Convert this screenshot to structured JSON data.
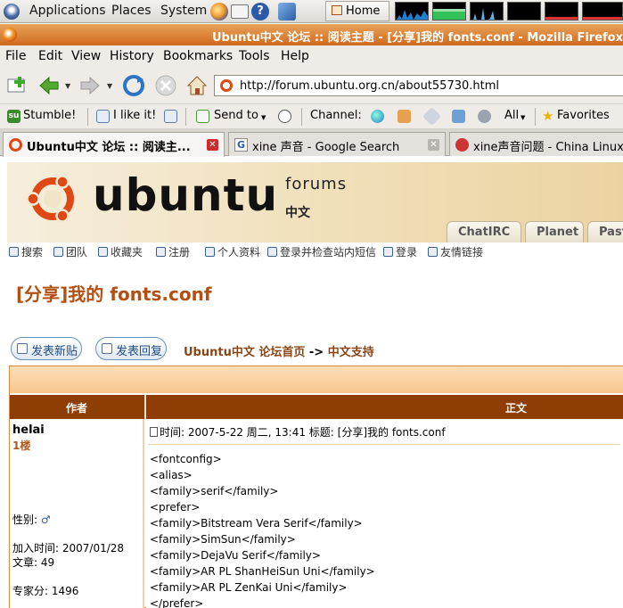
{
  "panel": {
    "applications": "Applications",
    "places": "Places",
    "system": "System",
    "home": "Home"
  },
  "window": {
    "title": "Ubuntu中文 论坛 :: 阅读主题 - [分享]我的 fonts.conf - Mozilla Firefox"
  },
  "menu": {
    "file": "File",
    "edit": "Edit",
    "view": "View",
    "history": "History",
    "bookmarks": "Bookmarks",
    "tools": "Tools",
    "help": "Help"
  },
  "nav": {
    "url": "http://forum.ubuntu.org.cn/about55730.html"
  },
  "stumble": {
    "stumble": "Stumble!",
    "like": "I like it!",
    "send_to": "Send to",
    "channel": "Channel:",
    "all": "All",
    "favorites": "Favorites"
  },
  "tabs": [
    {
      "label": "Ubuntu中文 论坛 :: 阅读主..."
    },
    {
      "label": "xine 声音 - Google Search"
    },
    {
      "label": "xine声音问题 - China Linux"
    }
  ],
  "banner": {
    "logo": "ubuntu",
    "forums": "forums",
    "zh": "中文",
    "tabs": [
      "ChatIRC",
      "Planet",
      "Past"
    ]
  },
  "navlinks": [
    "搜索",
    "团队",
    "收藏夹",
    "注册",
    "个人资料",
    "登录并检查站内短信",
    "登录",
    "友情链接"
  ],
  "topic": {
    "title": "[分享]我的 fonts.conf"
  },
  "actions": {
    "new_topic": "发表新贴",
    "reply": "发表回复"
  },
  "breadcrumb": {
    "home": "Ubuntu中文 论坛首页",
    "arrow": "->",
    "section": "中文支持"
  },
  "table": {
    "author_header": "作者",
    "body_header": "正文"
  },
  "author": {
    "name": "helai",
    "floor": "1楼",
    "gender_label": "性别:",
    "joined": "加入时间: 2007/01/28",
    "posts": "文章: 49",
    "score": "专家分: 1496"
  },
  "post": {
    "meta": "时间: 2007-5-22 周二, 13:41    标题: [分享]我的 fonts.conf",
    "lines": [
      "<fontconfig>",
      "<alias>",
      "<family>serif</family>",
      "<prefer>",
      "<family>Bitstream Vera Serif</family>",
      "<family>SimSun</family>",
      "<family>DejaVu Serif</family>",
      "<family>AR PL ShanHeiSun Uni</family>",
      "<family>AR PL ZenKai Uni</family>",
      "</prefer>"
    ]
  },
  "colors": {
    "title_orange": "#b44f12",
    "header_brown": "#8e3e05",
    "ubuntu_orange": "#dd4814"
  }
}
